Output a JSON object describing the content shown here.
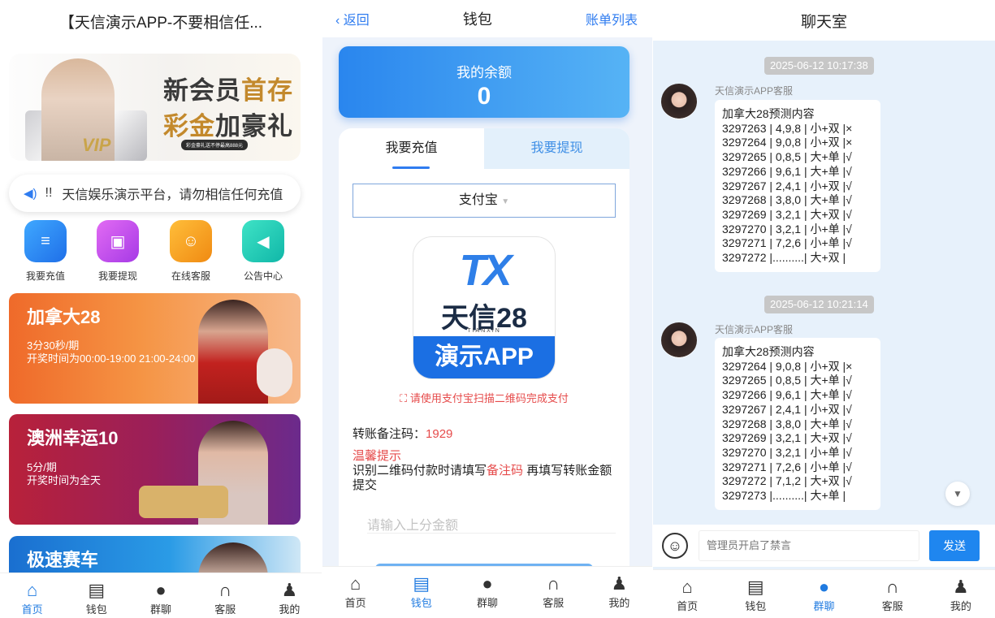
{
  "home": {
    "title": "【天信演示APP-不要相信任...",
    "banner": {
      "line1a": "新会员",
      "line1b": "首存",
      "line2a": "彩金",
      "line2b": "加豪礼",
      "sub": "彩金豪礼送不停最高888元",
      "vip": "VIP"
    },
    "notice": {
      "icon": "speaker-icon",
      "prefix": "!!",
      "text": "天信娱乐演示平台，请勿相信任何充值"
    },
    "quick": [
      {
        "label": "我要充值",
        "icon": "deposit-icon",
        "color": "#2f86f0"
      },
      {
        "label": "我要提现",
        "icon": "wallet-icon",
        "color": "#c44df0"
      },
      {
        "label": "在线客服",
        "icon": "support-icon",
        "color": "#f59a1e"
      },
      {
        "label": "公告中心",
        "icon": "megaphone-icon",
        "color": "#22d0b8"
      }
    ],
    "games": [
      {
        "title": "加拿大28",
        "line1": "3分30秒/期",
        "line2": "开奖时间为00:00-19:00 21:00-24:00"
      },
      {
        "title": "澳洲幸运10",
        "line1": "5分/期",
        "line2": "开奖时间为全天"
      },
      {
        "title": "极速赛车",
        "line1": "",
        "line2": ""
      }
    ]
  },
  "tabbar": [
    "首页",
    "钱包",
    "群聊",
    "客服",
    "我的"
  ],
  "wallet": {
    "back": "返回",
    "title": "钱包",
    "bill": "账单列表",
    "balance_label": "我的余额",
    "balance": "0",
    "tab_deposit": "我要充值",
    "tab_withdraw": "我要提现",
    "method": "支付宝",
    "logo_top": "TX",
    "logo_mid": "天信28",
    "logo_en": "TIANXIN",
    "logo_bottom": "演示APP",
    "scan_hint": "请使用支付宝扫描二维码完成支付",
    "ref_label": "转账备注码：",
    "ref_code": "1929",
    "tip_title": "温馨提示",
    "tip_a": "识别二维码付款时请填写",
    "tip_b": "备注码",
    "tip_c": " 再填写转账金额提交",
    "amount_placeholder": "请输入上分金额"
  },
  "chat": {
    "title": "聊天室",
    "messages": [
      {
        "time": "2025-06-12 10:17:38",
        "sender": "天信演示APP客服",
        "lines": [
          "加拿大28预测内容",
          "3297263 | 4,9,8 | 小+双 |×",
          "3297264 | 9,0,8 | 小+双 |×",
          "3297265 | 0,8,5 | 大+单 |√",
          "3297266 | 9,6,1 | 大+单 |√",
          "3297267 | 2,4,1 | 小+双 |√",
          "3297268 | 3,8,0 | 大+单 |√",
          "3297269 | 3,2,1 | 大+双 |√",
          "3297270 | 3,2,1 | 小+单 |√",
          "3297271 | 7,2,6 | 小+单 |√",
          "3297272 |..........| 大+双 |"
        ]
      },
      {
        "time": "2025-06-12 10:21:14",
        "sender": "天信演示APP客服",
        "lines": [
          "加拿大28预测内容",
          "3297264 | 9,0,8 | 小+双 |×",
          "3297265 | 0,8,5 | 大+单 |√",
          "3297266 | 9,6,1 | 大+单 |√",
          "3297267 | 2,4,1 | 小+双 |√",
          "3297268 | 3,8,0 | 大+单 |√",
          "3297269 | 3,2,1 | 大+双 |√",
          "3297270 | 3,2,1 | 小+单 |√",
          "3297271 | 7,2,6 | 小+单 |√",
          "3297272 | 7,1,2 | 大+双 |√",
          "3297273 |..........| 大+单 |"
        ]
      }
    ],
    "input_placeholder": "管理员开启了禁言",
    "send": "发送"
  }
}
